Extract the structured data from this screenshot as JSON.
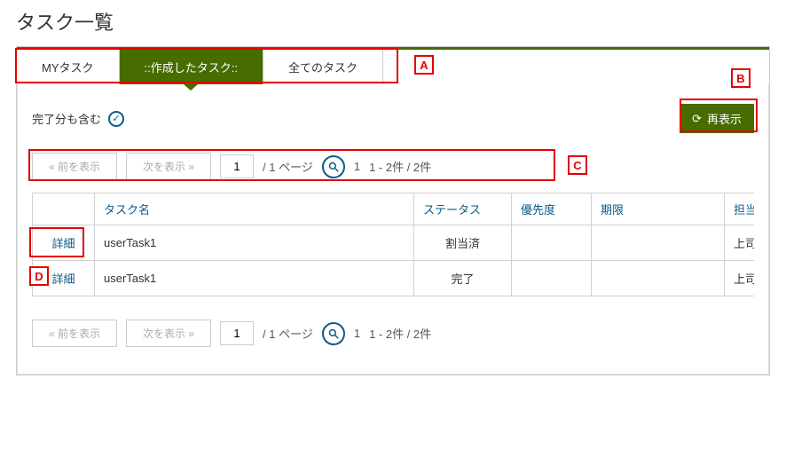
{
  "page_title": "タスク一覧",
  "tabs": {
    "my": "MYタスク",
    "created": "::作成したタスク::",
    "all": "全てのタスク"
  },
  "filter": {
    "include_completed": "完了分も含む",
    "refresh": "再表示"
  },
  "pager": {
    "prev": "«  前を表示",
    "next": "次を表示  »",
    "page_current": "1",
    "page_suffix": "/  1 ページ",
    "count_page": "1",
    "count_range": "1 - 2件 / 2件"
  },
  "table": {
    "headers": {
      "detail": "",
      "task_name": "タスク名",
      "status": "ステータス",
      "priority": "優先度",
      "due": "期限",
      "assignee": "担当"
    },
    "rows": [
      {
        "detail": "詳細",
        "task_name": "userTask1",
        "status": "割当済",
        "priority": "",
        "due": "",
        "assignee": "上司"
      },
      {
        "detail": "詳細",
        "task_name": "userTask1",
        "status": "完了",
        "priority": "",
        "due": "",
        "assignee": "上司"
      }
    ]
  },
  "annotations": {
    "a": "A",
    "b": "B",
    "c": "C",
    "d": "D"
  }
}
